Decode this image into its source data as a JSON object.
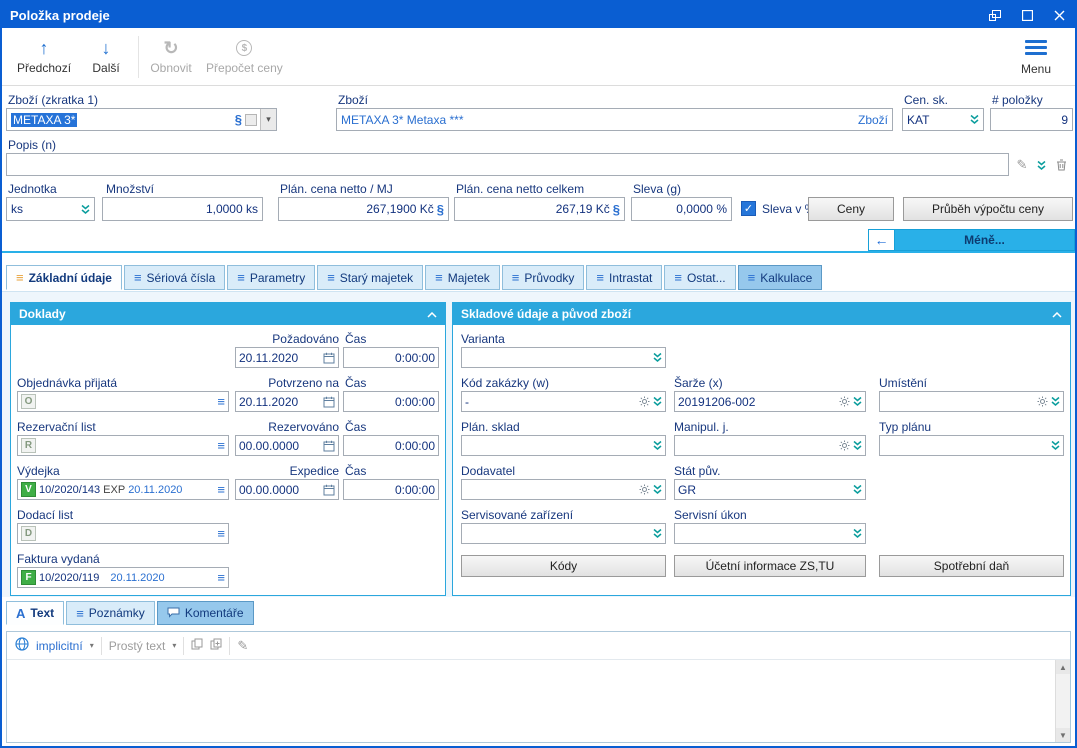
{
  "colors": {
    "titlebar_blue": "#0a5ed2",
    "accent_cyan": "#29b0e8",
    "panel_header_cyan": "#2ba7dd",
    "label_navy": "#17377e",
    "link_blue": "#2a6fd0",
    "badge_green": "#3fae46",
    "tab_bg": "#d9ecf9",
    "content_bg": "#eef6fc",
    "selection_blue": "#2673d8"
  },
  "title_bar": {
    "title": "Položka prodeje"
  },
  "toolbar": {
    "previous": "Předchozí",
    "next": "Další",
    "refresh": "Obnovit",
    "recalculate": "Přepočet ceny",
    "menu": "Menu"
  },
  "header_form": {
    "product_short": {
      "label": "Zboží (zkratka 1)",
      "value": "METAXA 3*"
    },
    "product": {
      "label": "Zboží",
      "value": "METAXA 3* Metaxa ***",
      "button_label": "Zboží"
    },
    "price_group": {
      "label": "Cen. sk.",
      "value": "KAT"
    },
    "item_count": {
      "label": "# položky",
      "value": "9"
    },
    "description": {
      "label": "Popis (n)",
      "value": ""
    },
    "unit": {
      "label": "Jednotka",
      "value": "ks"
    },
    "quantity": {
      "label": "Množství",
      "value": "1,0000 ks"
    },
    "unit_price": {
      "label": "Plán. cena netto / MJ",
      "value": "267,1900 Kč"
    },
    "total_price": {
      "label": "Plán. cena netto celkem",
      "value": "267,19 Kč"
    },
    "discount": {
      "label": "Sleva (g)",
      "value": "0,0000 %"
    },
    "discount_checkbox_label": "Sleva v %",
    "discount_checkbox_checked": true,
    "prices_button": "Ceny",
    "price_progress_button": "Průběh výpočtu ceny",
    "less_button": "Méně..."
  },
  "tabs": [
    "Základní údaje",
    "Sériová čísla",
    "Parametry",
    "Starý majetek",
    "Majetek",
    "Průvodky",
    "Intrastat",
    "Ostat...",
    "Kalkulace"
  ],
  "documents_panel": {
    "title": "Doklady",
    "requested_label": "Požadováno",
    "requested_date": "20.11.2020",
    "requested_time_label": "Čas",
    "requested_time": "0:00:00",
    "order_received": {
      "label": "Objednávka přijatá",
      "badge": "O",
      "value": ""
    },
    "confirmed_label": "Potvrzeno na",
    "confirmed_date": "20.11.2020",
    "confirmed_time_label": "Čas",
    "confirmed_time": "0:00:00",
    "reservation": {
      "label": "Rezervační list",
      "badge": "R",
      "value": ""
    },
    "reserved_label": "Rezervováno",
    "reserved_date": "00.00.0000",
    "reserved_time_label": "Čas",
    "reserved_time": "0:00:00",
    "issue": {
      "label": "Výdejka",
      "badge": "V",
      "value": "10/2020/143",
      "tag": "EXP",
      "date": "20.11.2020"
    },
    "expedition_label": "Expedice",
    "expedition_date": "00.00.0000",
    "expedition_time_label": "Čas",
    "expedition_time": "0:00:00",
    "delivery_note": {
      "label": "Dodací list",
      "badge": "D",
      "value": ""
    },
    "invoice": {
      "label": "Faktura vydaná",
      "badge": "F",
      "value": "10/2020/119",
      "date": "20.11.2020"
    }
  },
  "stock_panel": {
    "title": "Skladové údaje a původ zboží",
    "variant": {
      "label": "Varianta",
      "value": ""
    },
    "order_code": {
      "label": "Kód zakázky (w)",
      "value": "-"
    },
    "batch": {
      "label": "Šarže (x)",
      "value": "20191206-002"
    },
    "location": {
      "label": "Umístění",
      "value": ""
    },
    "plan_warehouse": {
      "label": "Plán. sklad",
      "value": ""
    },
    "handling_unit": {
      "label": "Manipul. j.",
      "value": ""
    },
    "plan_type": {
      "label": "Typ plánu",
      "value": ""
    },
    "supplier": {
      "label": "Dodavatel",
      "value": ""
    },
    "origin_country": {
      "label": "Stát pův.",
      "value": "GR"
    },
    "serviced_device": {
      "label": "Servisované zařízení",
      "value": ""
    },
    "service_task": {
      "label": "Servisní úkon",
      "value": ""
    },
    "codes_button": "Kódy",
    "accounting_button": "Účetní informace ZS,TU",
    "excise_button": "Spotřební daň"
  },
  "bottom_tabs": [
    "Text",
    "Poznámky",
    "Komentáře"
  ],
  "text_editor": {
    "language": "implicitní",
    "format": "Prostý text",
    "content": ""
  }
}
